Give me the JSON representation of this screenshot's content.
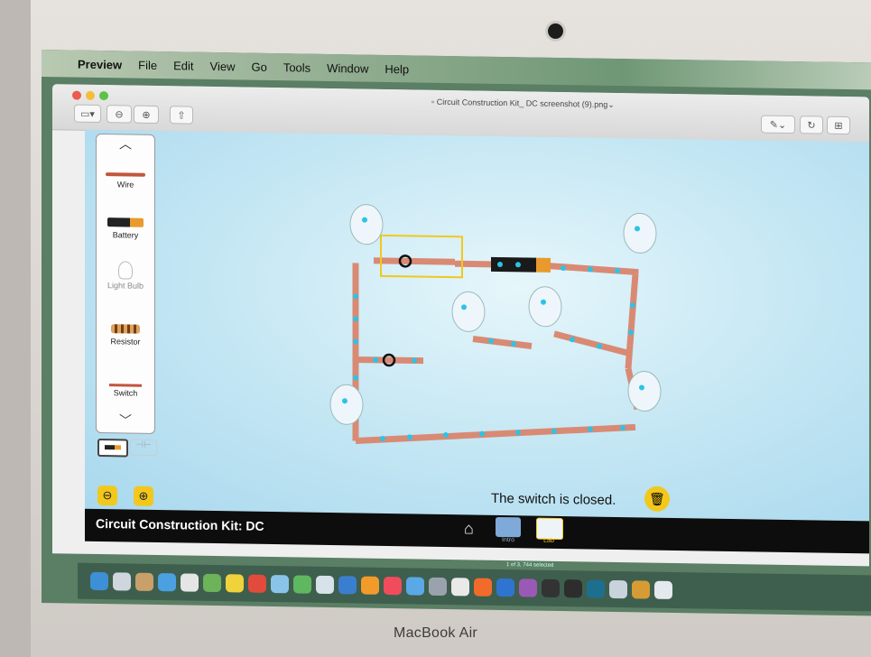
{
  "menubar": {
    "apple": "",
    "items": [
      "Preview",
      "File",
      "Edit",
      "View",
      "Go",
      "Tools",
      "Window",
      "Help"
    ]
  },
  "window": {
    "title": "Circuit Construction Kit_ DC screenshot (9).png",
    "title_suffix": "⌄"
  },
  "toolbox": {
    "items": [
      {
        "label": "Wire"
      },
      {
        "label": "Battery"
      },
      {
        "label": "Light Bulb"
      },
      {
        "label": "Resistor"
      },
      {
        "label": "Switch"
      }
    ]
  },
  "sim": {
    "status_text": "The switch is closed.",
    "zoom_out_icon": "zoom-out-icon",
    "zoom_in_icon": "zoom-in-icon",
    "trash_icon": "trash-icon"
  },
  "navbar": {
    "app_title": "Circuit Construction Kit: DC",
    "tabs": [
      {
        "label": "Intro",
        "color": "#7fa9d8"
      },
      {
        "label": "Lab",
        "color": "#eef3f7"
      }
    ]
  },
  "dock": {
    "caption": "1 of 3, 744 selected"
  },
  "device": {
    "label": "MacBook Air"
  },
  "colors": {
    "accent_yellow": "#f2c81c",
    "wire": "#d98a74",
    "electron": "#2cc3e6",
    "sim_bg": "#c7e8f4"
  }
}
